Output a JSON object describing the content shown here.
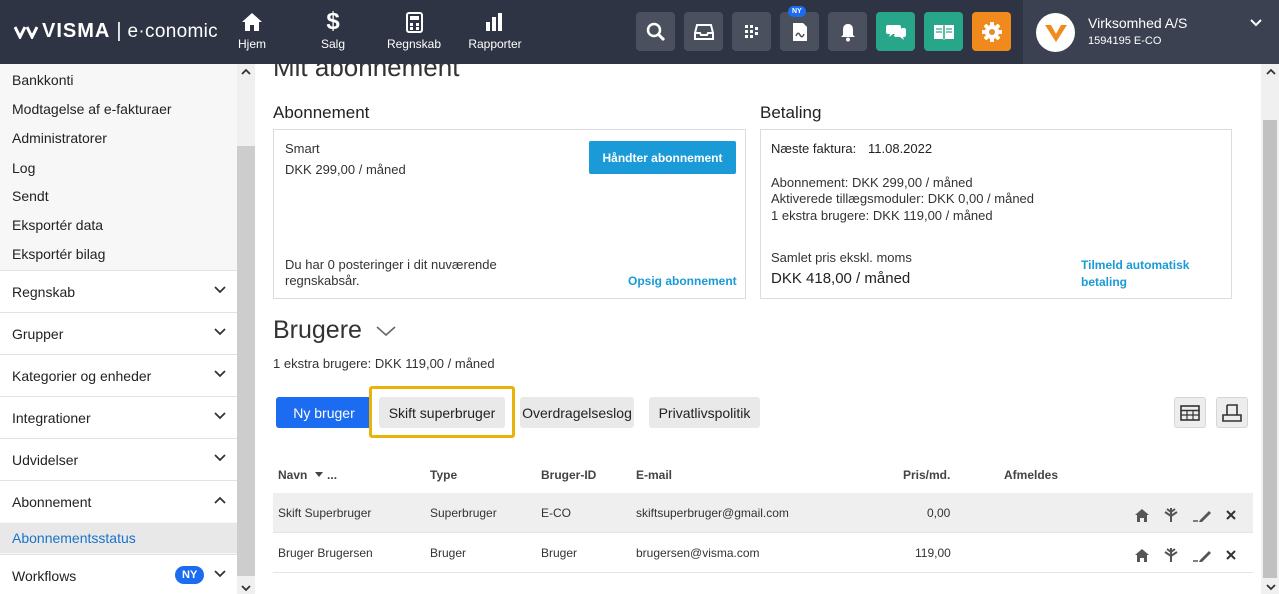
{
  "brand": {
    "logo": "VISMA",
    "separator": "|",
    "product": "e·conomic"
  },
  "nav": [
    {
      "label": "Hjem",
      "icon": "home-icon"
    },
    {
      "label": "Salg",
      "icon": "dollar-icon"
    },
    {
      "label": "Regnskab",
      "icon": "calculator-icon"
    },
    {
      "label": "Rapporter",
      "icon": "bar-chart-icon"
    }
  ],
  "top_icons": {
    "new_badge": "NY",
    "names": [
      "search-icon",
      "inbox-icon",
      "apps-grid-icon",
      "document-icon",
      "bell-icon",
      "chat-icon",
      "book-icon",
      "gear-icon"
    ]
  },
  "company": {
    "name": "Virksomhed A/S",
    "id": "1594195 E-CO"
  },
  "sidebar": {
    "subitems": [
      "Bankkonti",
      "Modtagelse af e-fakturaer",
      "Administratorer",
      "Log",
      "Sendt",
      "Eksportér data",
      "Eksportér bilag"
    ],
    "groups": [
      "Regnskab",
      "Grupper",
      "Kategorier og enheder",
      "Integrationer",
      "Udvidelser",
      "Abonnement"
    ],
    "active": "Abonnementsstatus",
    "workflows": "Workflows",
    "workflows_badge": "NY"
  },
  "page": {
    "title": "Mit abonnement",
    "subscription": {
      "heading": "Abonnement",
      "plan": "Smart",
      "price": "DKK 299,00 / måned",
      "manage_button": "Håndter abonnement",
      "postings_line1": "Du har 0 posteringer i dit nuværende",
      "postings_line2": "regnskabsår.",
      "cancel_link": "Opsig abonnement"
    },
    "payment": {
      "heading": "Betaling",
      "next_invoice_label": "Næste faktura:",
      "next_invoice_date": "11.08.2022",
      "line1": "Abonnement: DKK 299,00 / måned",
      "line2": "Aktiverede tillægsmoduler: DKK 0,00 / måned",
      "line3": "1 ekstra brugere: DKK 119,00 / måned",
      "total_label": "Samlet pris ekskl. moms",
      "total_value": "DKK 418,00 / måned",
      "auto_link_line1": "Tilmeld automatisk",
      "auto_link_line2": "betaling"
    },
    "users": {
      "heading": "Brugere",
      "extra_users": "1 ekstra brugere: DKK 119,00 / måned",
      "buttons": {
        "new_user": "Ny bruger",
        "switch_superuser": "Skift superbruger",
        "transfer_log": "Overdragelseslog",
        "privacy": "Privatlivspolitik"
      },
      "columns": {
        "name": "Navn",
        "more": "...",
        "type": "Type",
        "user_id": "Bruger-ID",
        "email": "E-mail",
        "price": "Pris/md.",
        "unsubscribe": "Afmeldes"
      },
      "rows": [
        {
          "name": "Skift Superbruger",
          "type": "Superbruger",
          "user_id": "E-CO",
          "email": "skiftsuperbruger@gmail.com",
          "price": "0,00"
        },
        {
          "name": "Bruger Brugersen",
          "type": "Bruger",
          "user_id": "Bruger",
          "email": "brugersen@visma.com",
          "price": "119,00"
        }
      ]
    }
  }
}
